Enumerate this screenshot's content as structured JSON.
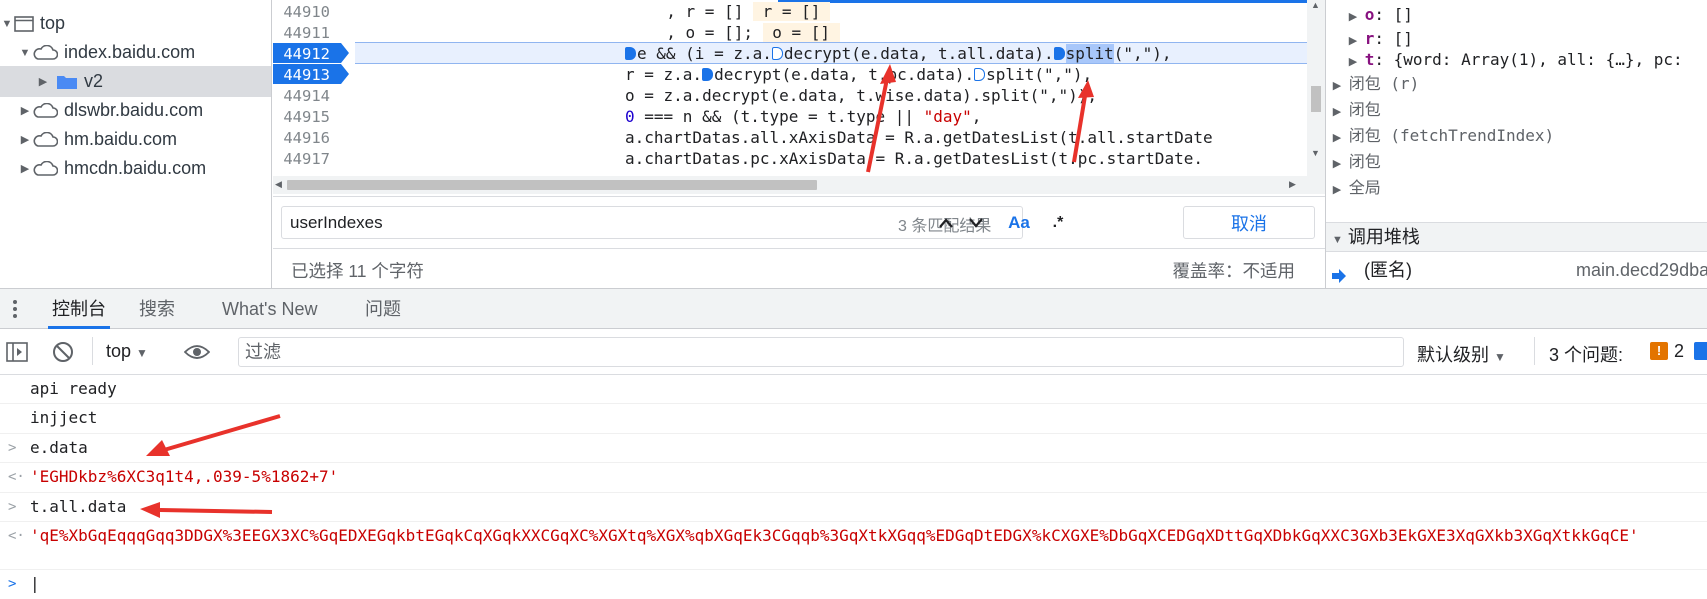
{
  "tree": {
    "items": [
      {
        "label": "top",
        "icon": "frame-icon",
        "expanded": true
      },
      {
        "label": "index.baidu.com",
        "icon": "cloud-icon",
        "expanded": true
      },
      {
        "label": "v2",
        "icon": "folder-icon",
        "expanded": false
      },
      {
        "label": "dlswbr.baidu.com",
        "icon": "cloud-icon",
        "expanded": false
      },
      {
        "label": "hm.baidu.com",
        "icon": "cloud-icon",
        "expanded": false
      },
      {
        "label": "hmcdn.baidu.com",
        "icon": "cloud-icon",
        "expanded": false
      }
    ]
  },
  "editor": {
    "line_numbers": [
      "44910",
      "44911",
      "44912",
      "44913",
      "44914",
      "44915",
      "44916",
      "44917"
    ],
    "breakpoint_lines": [
      "44912",
      "44913"
    ],
    "lines": [
      {
        "pre": "  , r = [] ",
        "hl": " r = [] "
      },
      {
        "pre": "  , o = []; ",
        "hl": " o = [] "
      },
      {
        "l1": "e && (i = z.a.",
        "l2": "decrypt(e.data, t.all.data).",
        "l3": "split",
        "l4": "(\",\"),"
      },
      {
        "l1": "r = z.a.",
        "l2": "decrypt(e.data, t.pc.data).",
        "l3": "split(\",\"),"
      },
      {
        "text": "o = z.a.decrypt(e.data, t.wise.data).split(\",\")),"
      },
      {
        "num": "0",
        "mid": " === n && (t.type = t.type || ",
        "str": "\"day\"",
        "end": ","
      },
      {
        "text": "a.chartDatas.all.xAxisData = R.a.getDatesList(t.all.startDate"
      },
      {
        "text": "a.chartDatas.pc.xAxisData = R.a.getDatesList(t.pc.startDate."
      }
    ]
  },
  "search": {
    "value": "userIndexes",
    "count": "3 条匹配结果",
    "match_case": "Aa",
    "regex": ".*",
    "cancel": "取消"
  },
  "status": {
    "selection": "已选择 11 个字符",
    "coverage": "覆盖率：不适用"
  },
  "scope": {
    "rows": [
      {
        "prop": "o",
        "val": ": []"
      },
      {
        "prop": "r",
        "val": ": []"
      },
      {
        "prop": "t",
        "val": ": {word: Array(1), all: {…}, pc:"
      }
    ],
    "closures": [
      "闭包 (r)",
      "闭包",
      "闭包 (fetchTrendIndex)",
      "闭包",
      "全局"
    ],
    "callstack_title": "调用堆栈",
    "callstack_item": "(匿名)",
    "callstack_file": "main.decd29dba"
  },
  "drawer": {
    "tabs": [
      "控制台",
      "搜索",
      "What's New",
      "问题"
    ]
  },
  "console_toolbar": {
    "context": "top",
    "filter_placeholder": "过滤",
    "level": "默认级别",
    "issues": "3 个问题:",
    "issue_count": "2"
  },
  "console": {
    "messages": [
      {
        "type": "log",
        "text": "api ready"
      },
      {
        "type": "log",
        "text": "injject"
      },
      {
        "type": "input",
        "text": "e.data"
      },
      {
        "type": "result",
        "text": "'EGHDkbz%6XC3q1t4,.039-5%1862+7'"
      },
      {
        "type": "input",
        "text": "t.all.data"
      },
      {
        "type": "result",
        "text": "'qE%XbGqEqqqGqq3DDGX%3EEGX3XC%GqEDXEGqkbtEGqkCqXGqkXXCGqXC%XGXtq%XGX%qbXGqEk3CGqqb%3GqXtkXGqq%EDGqDtEDGX%kCXGXE%DbGqXCEDGqXDttGqXDbkGqXXC3GXb3EkGXE3XqGXkb3XGqXtkkGqCE'"
      }
    ]
  },
  "colors": {
    "accent": "#1a73e8",
    "error_red": "#c80000",
    "annotation_arrow": "#e8322b"
  }
}
